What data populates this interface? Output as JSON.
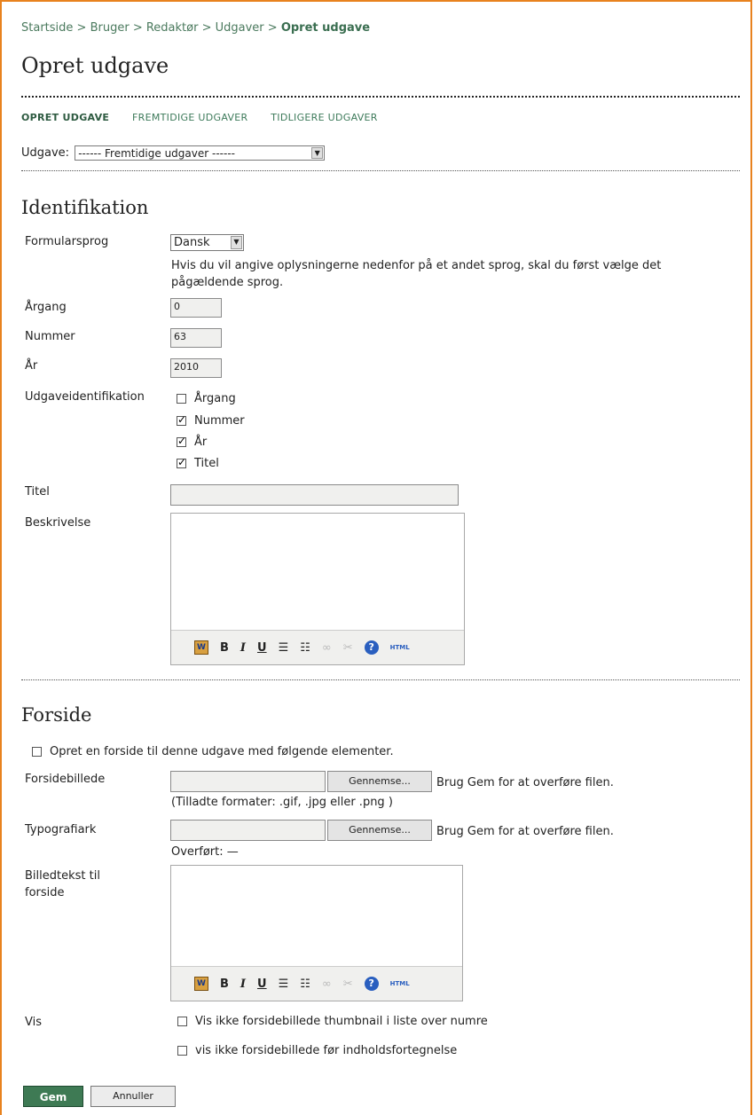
{
  "breadcrumb": {
    "items": [
      "Startside",
      "Bruger",
      "Redaktør",
      "Udgaver"
    ],
    "current": "Opret udgave",
    "separator": ">"
  },
  "page_title": "Opret udgave",
  "tabs": [
    {
      "label": "OPRET UDGAVE",
      "active": true
    },
    {
      "label": "FREMTIDIGE UDGAVER",
      "active": false
    },
    {
      "label": "TIDLIGERE UDGAVER",
      "active": false
    }
  ],
  "issue_select": {
    "label": "Udgave:",
    "value": "------ Fremtidige udgaver ------"
  },
  "identification": {
    "heading": "Identifikation",
    "form_language": {
      "label": "Formularsprog",
      "value": "Dansk",
      "help": "Hvis du vil angive oplysningerne nedenfor på et andet sprog, skal du først vælge det pågældende sprog."
    },
    "volume": {
      "label": "Årgang",
      "value": "0"
    },
    "number": {
      "label": "Nummer",
      "value": "63"
    },
    "year": {
      "label": "År",
      "value": "2010"
    },
    "issue_identification": {
      "label": "Udgaveidentifikation",
      "options": [
        {
          "label": "Årgang",
          "checked": false
        },
        {
          "label": "Nummer",
          "checked": true
        },
        {
          "label": "År",
          "checked": true
        },
        {
          "label": "Titel",
          "checked": true
        }
      ]
    },
    "title": {
      "label": "Titel",
      "value": ""
    },
    "description": {
      "label": "Beskrivelse",
      "value": ""
    }
  },
  "cover": {
    "heading": "Forside",
    "create_cover": {
      "label": "Opret en forside til denne udgave med følgende elementer.",
      "checked": false
    },
    "cover_image": {
      "label": "Forsidebillede",
      "browse": "Gennemse...",
      "hint": "Brug Gem for at overføre filen.",
      "formats": "(Tilladte formater: .gif, .jpg eller .png )"
    },
    "stylesheet": {
      "label": "Typografiark",
      "browse": "Gennemse...",
      "hint": "Brug Gem for at overføre filen.",
      "uploaded": "Overført: —"
    },
    "caption": {
      "label_line1": "Billedtekst til",
      "label_line2": "forside"
    },
    "display": {
      "label": "Vis",
      "options": [
        {
          "label": "Vis ikke forsidebillede thumbnail i liste over numre",
          "checked": false
        },
        {
          "label": "vis ikke forsidebillede før indholdsfortegnelse",
          "checked": false
        }
      ]
    }
  },
  "toolbar": {
    "paste_word": "W",
    "bold": "B",
    "italic": "I",
    "underline": "U",
    "bullets": "☰",
    "numbered": "☷",
    "link": "∞",
    "unlink": "✂",
    "help": "?",
    "html": "HTML"
  },
  "actions": {
    "save": "Gem",
    "cancel": "Annuller"
  }
}
